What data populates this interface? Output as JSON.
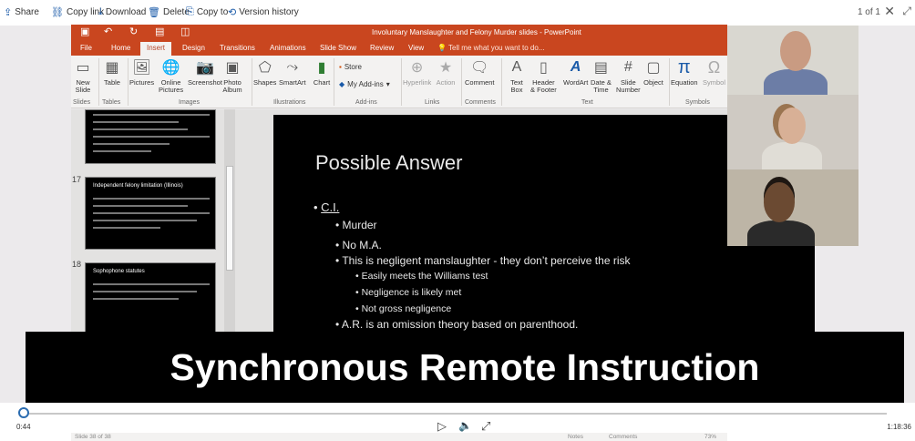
{
  "toolbar": {
    "share": "Share",
    "copy_link": "Copy link",
    "download": "Download",
    "delete": "Delete",
    "copy_to": "Copy to",
    "version_history": "Version history",
    "page_count": "1 of 1"
  },
  "ppt": {
    "doc_title": "Involuntary Manslaughter and Felony Murder slides - PowerPoint",
    "tabs": [
      "File",
      "Home",
      "Insert",
      "Design",
      "Transitions",
      "Animations",
      "Slide Show",
      "Review",
      "View"
    ],
    "tell_me": "Tell me what you want to do...",
    "ribbon": {
      "new_slide": "New\nSlide",
      "table": "Table",
      "pictures": "Pictures",
      "online_pictures": "Online\nPictures",
      "screenshot": "Screenshot",
      "photo_album": "Photo\nAlbum",
      "shapes": "Shapes",
      "smartart": "SmartArt",
      "chart": "Chart",
      "store": "Store",
      "my_addins": "My Add-ins",
      "hyperlink": "Hyperlink",
      "action": "Action",
      "comment": "Comment",
      "text_box": "Text\nBox",
      "header_footer": "Header\n& Footer",
      "wordart": "WordArt",
      "date_time": "Date &\nTime",
      "slide_number": "Slide\nNumber",
      "object": "Object",
      "equation": "Equation",
      "symbol": "Symbol"
    },
    "groups": {
      "slides": "Slides",
      "tables": "Tables",
      "images": "Images",
      "illustrations": "Illustrations",
      "addins": "Add-ins",
      "links": "Links",
      "comments": "Comments",
      "text": "Text",
      "symbols": "Symbols"
    },
    "thumbs": {
      "n17": "17",
      "n18": "18",
      "t17": "Independent felony limitation (Illinois)",
      "t18": "Sophophone statutes"
    },
    "slide": {
      "title": "Possible Answer",
      "b1": "C.I.",
      "b2": "Murder",
      "b3": "No M.A.",
      "b4": "This is negligent manslaughter  - they don’t perceive the risk",
      "b5": "Easily meets the Williams test",
      "b6": "Negligence is likely met",
      "b7": "Not gross negligence",
      "b8": "A.R. is an omission theory based on parenthood."
    },
    "status": {
      "slide_of": "Slide 38 of 38",
      "notes": "Notes",
      "comments": "Comments",
      "zoom": "73%"
    }
  },
  "caption": "Synchronous Remote Instruction",
  "player": {
    "elapsed": "0:44",
    "total": "1:18:36"
  }
}
